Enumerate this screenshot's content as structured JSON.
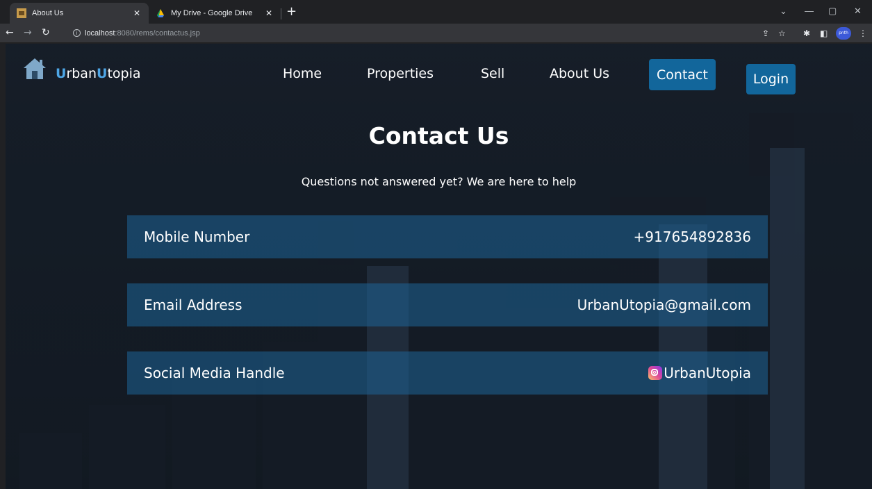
{
  "browser": {
    "tabs": [
      {
        "title": "About Us",
        "active": true,
        "favicon": "site-favicon-icon"
      },
      {
        "title": "My Drive - Google Drive",
        "active": false,
        "favicon": "google-drive-icon"
      }
    ],
    "url_host": "localhost",
    "url_path": ":8080/rems/contactus.jsp",
    "profile_label": "pnth"
  },
  "site": {
    "brand_prefix": "U",
    "brand_rest1": "rban",
    "brand_mid": "U",
    "brand_rest2": "topia",
    "nav": {
      "home": "Home",
      "properties": "Properties",
      "sell": "Sell",
      "about": "About Us",
      "contact": "Contact",
      "login": "Login"
    }
  },
  "page": {
    "title": "Contact Us",
    "subtitle": "Questions not answered yet? We are here to help",
    "rows": [
      {
        "label": "Mobile Number",
        "value": "+917654892836"
      },
      {
        "label": "Email Address",
        "value": "UrbanUtopia@gmail.com"
      },
      {
        "label": "Social Media Handle",
        "value": "UrbanUtopia",
        "icon": "instagram-icon"
      }
    ]
  },
  "colors": {
    "accent": "#12669b",
    "brand_accent": "#4ea6e6",
    "row_bg": "#1d6498"
  }
}
